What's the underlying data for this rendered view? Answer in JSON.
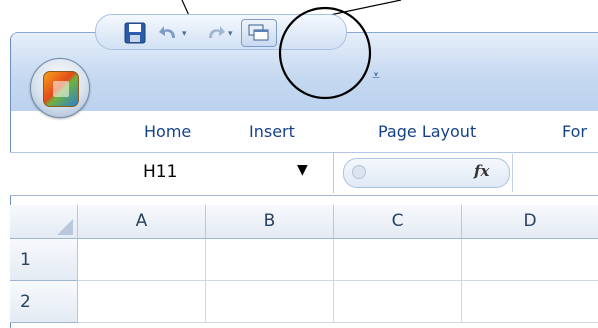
{
  "ribbon": {
    "tabs": [
      {
        "label": "Home"
      },
      {
        "label": "Insert"
      },
      {
        "label": "Page Layout"
      },
      {
        "label": "For"
      }
    ]
  },
  "formula_bar": {
    "name_box_value": "H11",
    "function_label": "fx"
  },
  "sheet": {
    "columns": [
      "A",
      "B",
      "C",
      "D"
    ],
    "rows": [
      "1",
      "2"
    ]
  },
  "icons": [
    "office-button-icon",
    "save-icon",
    "undo-icon",
    "redo-icon",
    "switch-windows-icon",
    "customize-qat-icon"
  ]
}
